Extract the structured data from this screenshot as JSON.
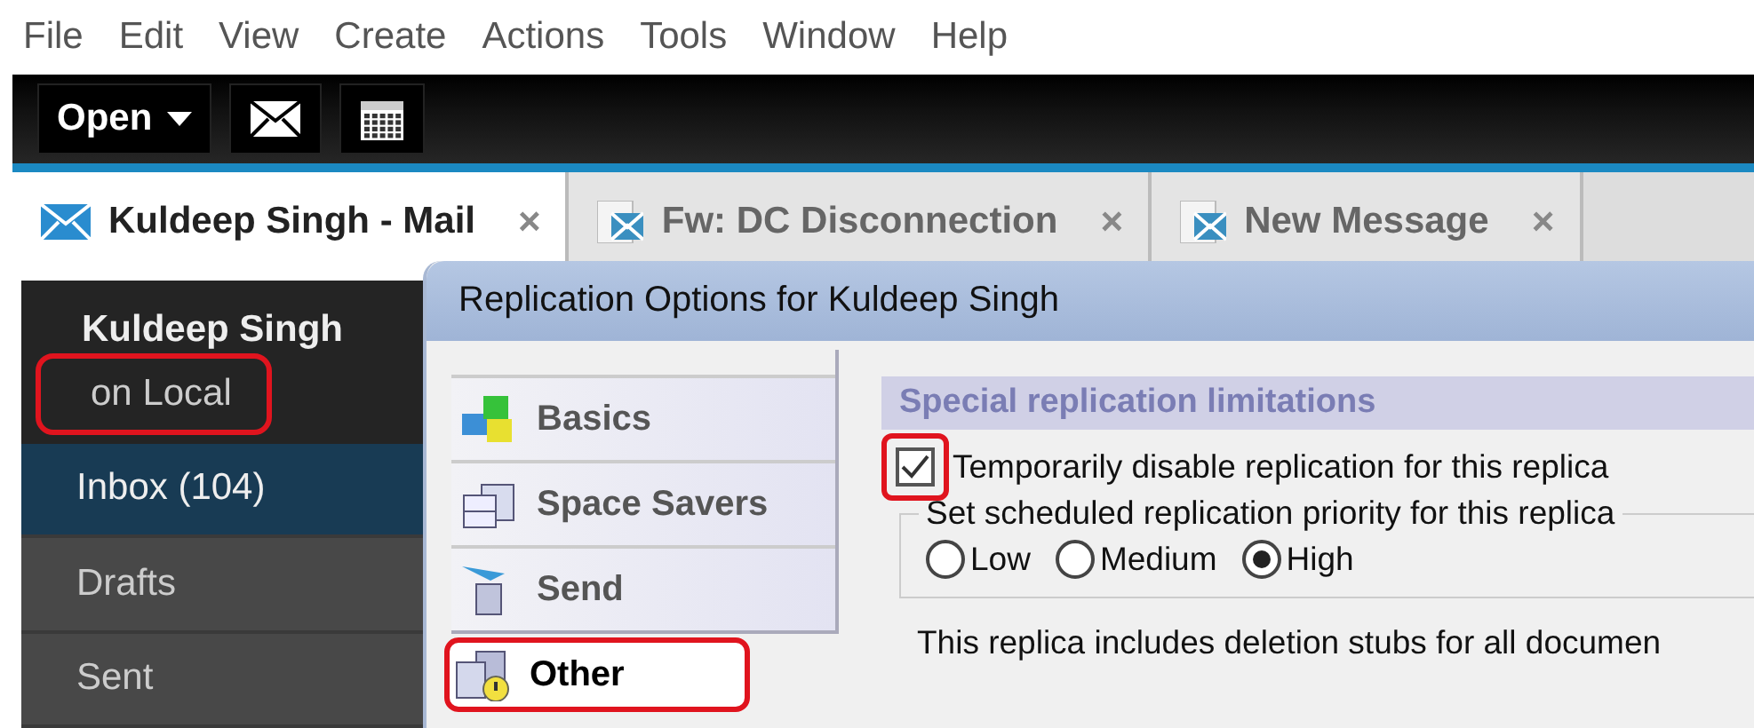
{
  "menu": [
    "File",
    "Edit",
    "View",
    "Create",
    "Actions",
    "Tools",
    "Window",
    "Help"
  ],
  "toolbar": {
    "open_label": "Open"
  },
  "tabs": [
    {
      "label": "Kuldeep Singh - Mail",
      "kind": "mail",
      "selected": true,
      "close": "×"
    },
    {
      "label": "Fw: DC Disconnection",
      "kind": "memo",
      "selected": false,
      "close": "×"
    },
    {
      "label": "New Message",
      "kind": "memo",
      "selected": false,
      "close": "×"
    }
  ],
  "sidebar": {
    "title": "Kuldeep Singh",
    "subtitle": "on Local",
    "subtitle_highlighted": true,
    "items": [
      {
        "label": "Inbox (104)",
        "selected": true
      },
      {
        "label": "Drafts",
        "selected": false
      },
      {
        "label": "Sent",
        "selected": false
      }
    ]
  },
  "dialog": {
    "title": "Replication Options for Kuldeep Singh",
    "nav": [
      {
        "label": "Basics",
        "kind": "basics",
        "selected": false,
        "highlighted": false
      },
      {
        "label": "Space Savers",
        "kind": "space",
        "selected": false,
        "highlighted": false
      },
      {
        "label": "Send",
        "kind": "send",
        "selected": false,
        "highlighted": false
      },
      {
        "label": "Other",
        "kind": "other",
        "selected": true,
        "highlighted": true
      }
    ],
    "section": "Special replication limitations",
    "disable_checkbox": {
      "label": "Temporarily disable replication for this replica",
      "checked": true,
      "highlighted": true
    },
    "priority": {
      "legend": "Set scheduled replication priority for this replica",
      "options": [
        {
          "label": "Low",
          "selected": false
        },
        {
          "label": "Medium",
          "selected": false
        },
        {
          "label": "High",
          "selected": true
        }
      ]
    },
    "note": "This replica includes deletion stubs for all documen"
  }
}
